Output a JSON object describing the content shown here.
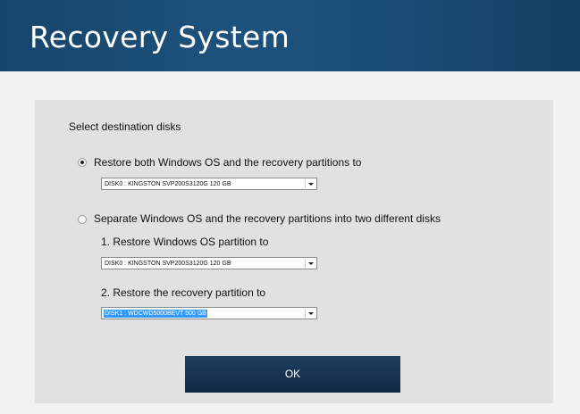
{
  "header": {
    "title": "Recovery System"
  },
  "panel": {
    "heading": "Select destination disks",
    "option_both": {
      "label": "Restore both Windows OS and the recovery partitions to",
      "checked": true,
      "disk": "DISK0 : KINGSTON SVP200S3120G 120 GB"
    },
    "option_separate": {
      "label": "Separate Windows OS and the recovery partitions into two different disks",
      "checked": false,
      "os_label": "1. Restore Windows OS partition to",
      "os_disk": "DISK0 : KINGSTON SVP200S3120G 120 GB",
      "recovery_label": "2. Restore the recovery partition to",
      "recovery_disk": "DISK1 : WDCWD5000BEVT 500 GB"
    }
  },
  "ok_label": "OK",
  "colors": {
    "header": "#1d527c",
    "ok_button": "#0f2943",
    "selection": "#3399ff"
  }
}
